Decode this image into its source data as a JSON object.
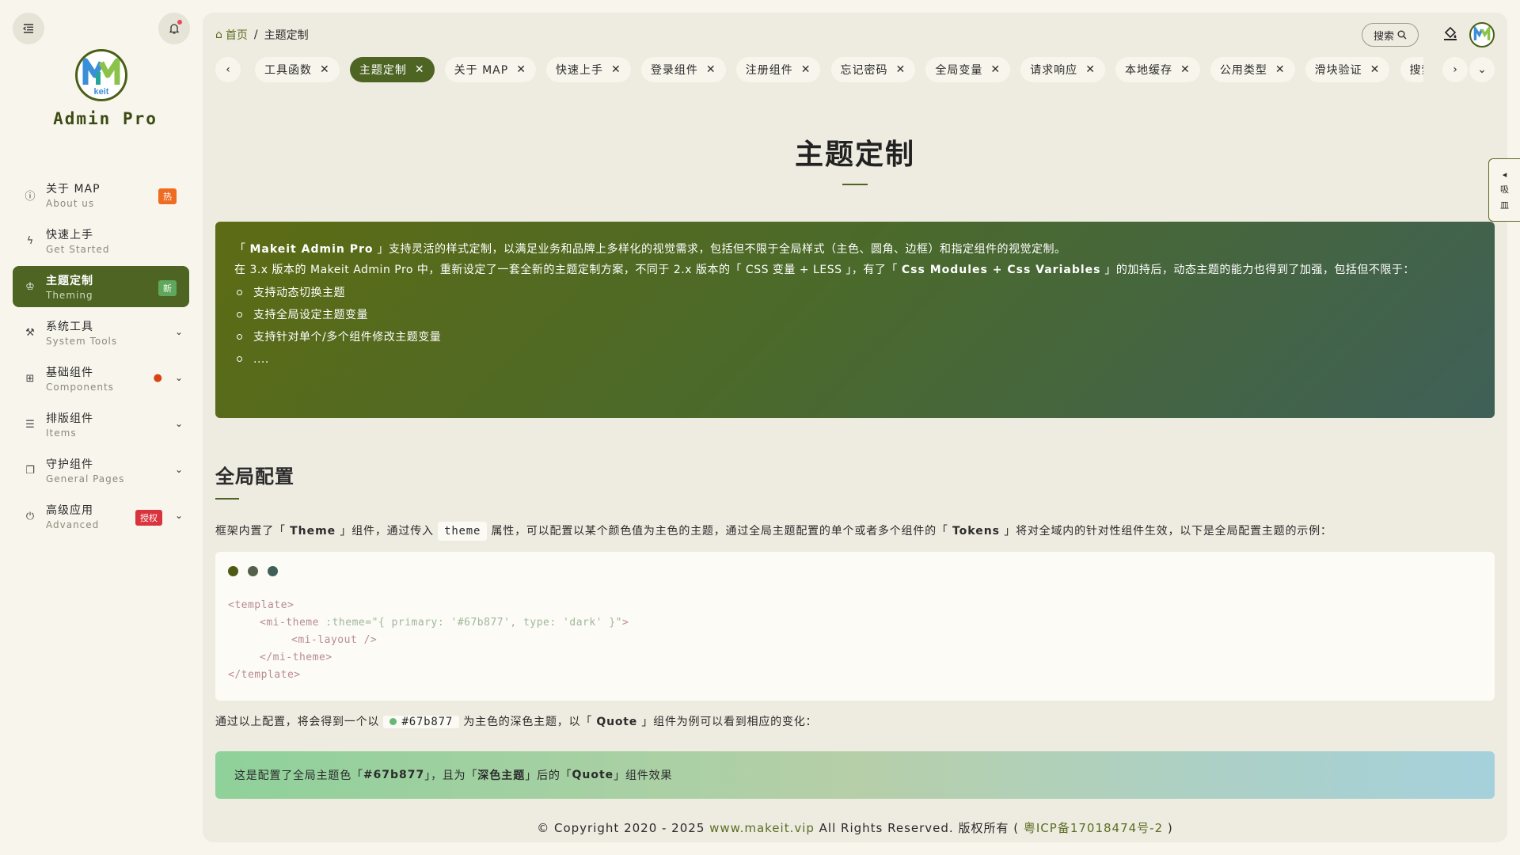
{
  "sidebar": {
    "brand": "Admin Pro",
    "logo_text": "keit",
    "items": [
      {
        "label": "关于 MAP",
        "sub": "About us",
        "badge": "热"
      },
      {
        "label": "快速上手",
        "sub": "Get Started"
      },
      {
        "label": "主题定制",
        "sub": "Theming",
        "badge": "新"
      },
      {
        "label": "系统工具",
        "sub": "System Tools"
      },
      {
        "label": "基础组件",
        "sub": "Components"
      },
      {
        "label": "排版组件",
        "sub": "Items"
      },
      {
        "label": "守护组件",
        "sub": "General Pages"
      },
      {
        "label": "高级应用",
        "sub": "Advanced",
        "badge": "授权"
      }
    ]
  },
  "header": {
    "breadcrumb_home": "首页",
    "breadcrumb_sep": "/",
    "breadcrumb_current": "主题定制",
    "search_label": "搜索"
  },
  "tabs": [
    "工具函数",
    "主题定制",
    "关于 MAP",
    "快速上手",
    "登录组件",
    "注册组件",
    "忘记密码",
    "全局变量",
    "请求响应",
    "本地缓存",
    "公用类型",
    "滑块验证",
    "搜索"
  ],
  "content": {
    "title": "主题定制",
    "intro_p1_a": "「 ",
    "intro_p1_brand": "Makeit Admin Pro",
    "intro_p1_b": " 」支持灵活的样式定制，以满足业务和品牌上多样化的视觉需求，包括但不限于全局样式（主色、圆角、边框）和指定组件的视觉定制。",
    "intro_p2_a": "在 3.x 版本的 Makeit Admin Pro 中，重新设定了一套全新的主题定制方案，不同于 2.x 版本的「 CSS 变量 + LESS 」，有了「 ",
    "intro_p2_bold": "Css Modules + Css Variables",
    "intro_p2_b": " 」的加持后，动态主题的能力也得到了加强，包括但不限于：",
    "intro_list": [
      "支持动态切换主题",
      "支持全局设定主题变量",
      "支持针对单个/多个组件修改主题变量",
      "...."
    ],
    "section_title": "全局配置",
    "para1_a": "框架内置了「 ",
    "para1_theme": "Theme",
    "para1_b": " 」组件，通过传入",
    "para1_code": "theme",
    "para1_c": "属性，可以配置以某个颜色值为主色的主题，通过全局主题配置的单个或者多个组件的「 ",
    "para1_tokens": "Tokens",
    "para1_d": " 」将对全域内的针对性组件生效，以下是全局配置主题的示例：",
    "code_lines": {
      "l1": "<template>",
      "l2_tag": "<mi-theme ",
      "l2_attr": ":theme=\"{ primary: '#67b877', type: 'dark' }\"",
      "l2_end": ">",
      "l3": "<mi-layout />",
      "l4": "</mi-theme>",
      "l5": "</template>"
    },
    "para2_a": "通过以上配置，将会得到一个以",
    "para2_color": "#67b877",
    "para2_b": "为主色的深色主题，以「 ",
    "para2_quote": "Quote",
    "para2_c": " 」组件为例可以看到相应的变化：",
    "quote_a": "这是配置了全局主题色「 ",
    "quote_color": "#67b877",
    "quote_b": " 」，且为「 ",
    "quote_dark": "深色主题",
    "quote_c": " 」后的「 ",
    "quote_comp": "Quote",
    "quote_d": " 」组件效果"
  },
  "footer": {
    "prefix": "© Copyright 2020 - 2025 ",
    "site": "www.makeit.vip",
    "middle": " All Rights Reserved. 版权所有 ( ",
    "icp": "粤ICP备17018474号-2",
    "suffix": " )"
  },
  "side_tab": {
    "text1": "吸",
    "text2": "皿"
  },
  "colors": {
    "accent": "#4d6423",
    "primary": "#67b877",
    "dot1": "#4d5a14",
    "dot2": "#55604a",
    "dot3": "#3f6058"
  }
}
